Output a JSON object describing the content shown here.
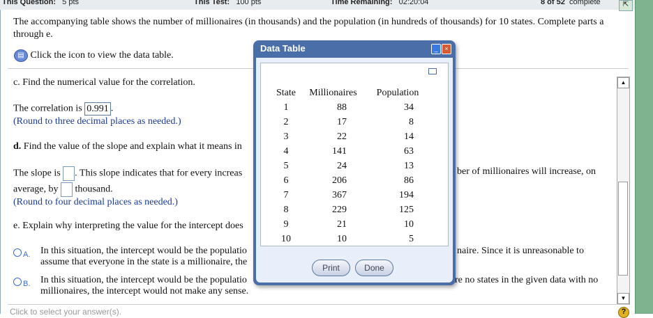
{
  "topbar": {
    "question_label": "This Question:",
    "question_pts": "5 pts",
    "test_label": "This Test:",
    "test_pts": "100 pts",
    "time_label": "Time Remaining:",
    "time_value": "02:20:04",
    "progress": "8 of 52",
    "progress_suffix": "complete"
  },
  "question": {
    "intro_1": "The accompanying table shows the number of millionaires (in thousands) and the population (in hundreds of thousands) for 10 states. Complete parts a",
    "intro_2": "through e.",
    "data_link": "Click the icon to view the data table.",
    "c_prompt": "c. Find the numerical value for the correlation.",
    "c_answer_pre": "The correlation is",
    "c_answer_value": "0.991",
    "c_answer_post": ".",
    "c_hint": "(Round to three decimal places as needed.)",
    "d_label": "d.",
    "d_prompt": "Find the value of the slope and explain what it means in",
    "slope_pre": "The slope is",
    "slope_mid": ". This slope indicates that for every increas",
    "slope_right": "ber of millionaires will increase, on",
    "slope_line2_pre": "average, by",
    "slope_line2_post": "thousand.",
    "d_hint": "(Round to four decimal places as needed.)",
    "e_prompt": "e. Explain why interpreting the value for the intercept does",
    "options": [
      {
        "letter": "A.",
        "line1_left": "In this situation, the intercept would be the populatio",
        "line1_right": "naire. Since it is unreasonable to",
        "line2": "assume that everyone in the state is a millionaire, the"
      },
      {
        "letter": "B.",
        "line1_left": "In this situation, the intercept would be the populatio",
        "line1_right": "re no states in the given data with no",
        "line2": "millionaires, the intercept would not make any sense."
      }
    ],
    "footer": "Click to select your answer(s)."
  },
  "dialog": {
    "title": "Data Table",
    "headers": [
      "State",
      "Millionaires",
      "Population"
    ],
    "rows": [
      [
        "1",
        "88",
        "34"
      ],
      [
        "2",
        "17",
        "8"
      ],
      [
        "3",
        "22",
        "14"
      ],
      [
        "4",
        "141",
        "63"
      ],
      [
        "5",
        "24",
        "13"
      ],
      [
        "6",
        "206",
        "86"
      ],
      [
        "7",
        "367",
        "194"
      ],
      [
        "8",
        "229",
        "125"
      ],
      [
        "9",
        "21",
        "10"
      ],
      [
        "10",
        "10",
        "5"
      ]
    ],
    "print": "Print",
    "done": "Done"
  }
}
